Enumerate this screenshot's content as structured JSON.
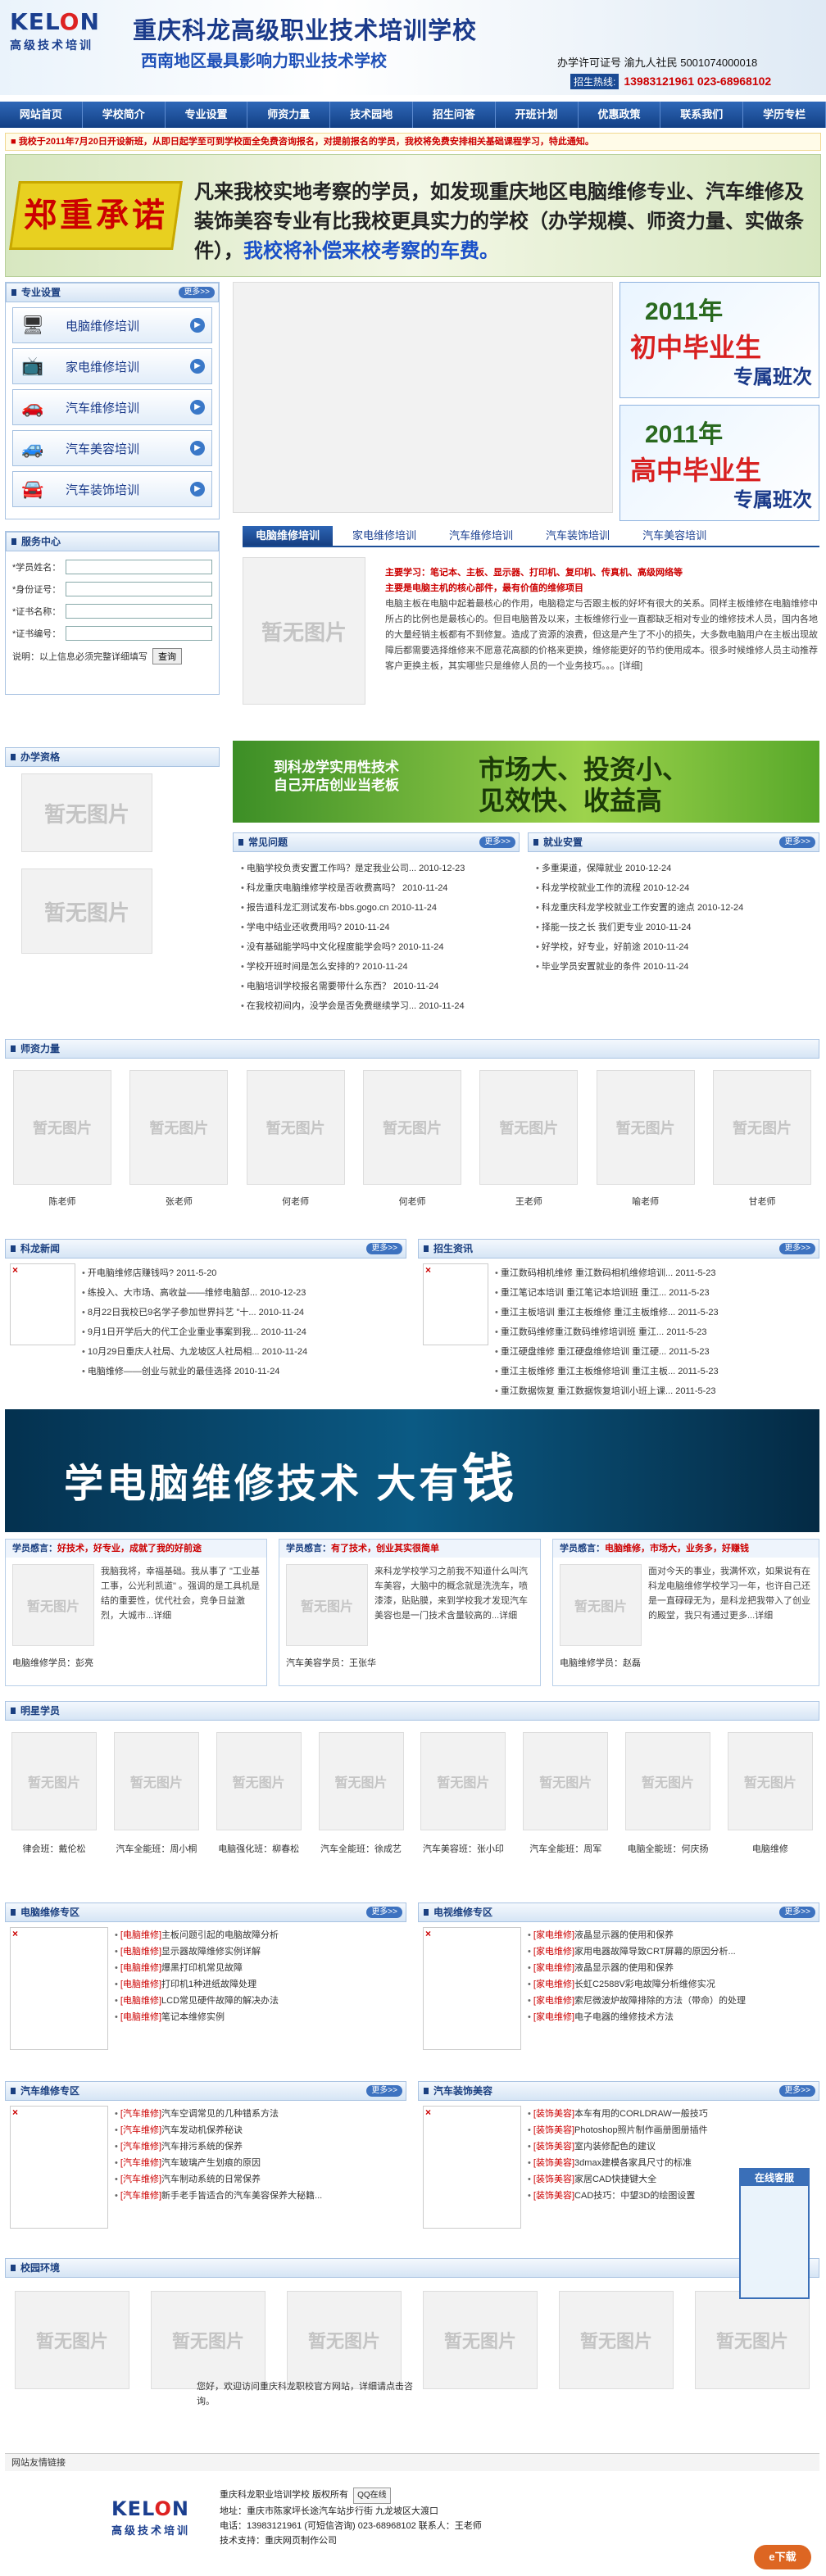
{
  "header": {
    "logo_mark_a": "KEL",
    "logo_mark_b": "O",
    "logo_mark_c": "N",
    "logo_sub": "高级技术培训",
    "title": "重庆科龙高级职业技术培训学校",
    "subtitle": "西南地区最具影响力职业技术学校",
    "license": "办学许可证号 渝九人社民 5001074000018",
    "phone_tag": "招生热线:",
    "phone": "13983121961  023-68968102"
  },
  "nav": [
    "网站首页",
    "学校简介",
    "专业设置",
    "师资力量",
    "技术园地",
    "招生问答",
    "开班计划",
    "优惠政策",
    "联系我们",
    "学历专栏"
  ],
  "notice": "■ 我校于2011年7月20日开设新班，从即日起学至可到学校面全免费咨询报名，对提前报名的学员，我校将免费安排相关基础课程学习，特此通知。",
  "promise": {
    "stamp": "郑重承诺",
    "text": "凡来我校实地考察的学员，如发现重庆地区电脑维修专业、汽车维修及装饰美容专业有比我校更具实力的学校（办学规模、师资力量、实做条件），",
    "highlight": "我校将补偿来校考察的车费。"
  },
  "major": {
    "title": "专业设置",
    "more": "更多>>",
    "items": [
      {
        "label": "电脑维修培训",
        "icon": "🖥"
      },
      {
        "label": "家电维修培训",
        "icon": "📺"
      },
      {
        "label": "汽车维修培训",
        "icon": "🚗"
      },
      {
        "label": "汽车美容培训",
        "icon": "🚙"
      },
      {
        "label": "汽车装饰培训",
        "icon": "🚘"
      }
    ]
  },
  "service": {
    "title": "服务中心",
    "fields": [
      "*学员姓名：",
      "*身份证号：",
      "*证书名称：",
      "*证书编号："
    ],
    "note": "说明：以上信息必须完整详细填写",
    "button": "查询"
  },
  "promos": [
    {
      "year": "2011年",
      "main": "初中毕业生",
      "tag": "专属班次"
    },
    {
      "year": "2011年",
      "main": "高中毕业生",
      "tag": "专属班次"
    }
  ],
  "placeholder": "暂无图片",
  "tabs": [
    "电脑维修培训",
    "家电维修培训",
    "汽车维修培训",
    "汽车装饰培训",
    "汽车美容培训"
  ],
  "tab_content": {
    "line1": "主要学习：笔记本、主板、显示器、打印机、复印机、传真机、高级网络等",
    "line2": "主要是电脑主机的核心部件，最有价值的维修项目",
    "body": "电脑主板在电脑中起着最核心的作用，电脑稳定与否跟主板的好坏有很大的关系。同样主板维修在电脑维修中所占的比例也是最核心的。但目电脑普及以来，主板维修行业一直都缺乏相对专业的维修技术人员，国内各地的大量经销主板都有不到修复。造成了资源的浪费，但这是产生了不小的损失，大多数电脑用户在主板出现故障后都需要选择维修来不愿意花高额的价格来更换，维修能更好的节约使用成本。很多时候维修人员主动推荐客户更换主板，其实哪些只是维修人员的一个业务技巧。。。[详细]"
  },
  "school": {
    "title": "办学资格"
  },
  "mid_banner": {
    "small": "到科龙学实用性技术\n自己开店创业当老板",
    "big": "市场大、投资小、\n见效快、收益高"
  },
  "faq": {
    "title": "常见问题",
    "more": "更多>>",
    "items": [
      "电脑学校负责安置工作吗？是定我业公司...  2010-12-23",
      "科龙重庆电脑维修学校是否收费高吗？  2010-11-24",
      "报告道科龙汇测试发布-bbs.gogo.cn 2010-11-24",
      "学电中结业还收费用吗?  2010-11-24",
      "没有基础能学吗中文化程度能学会吗?  2010-11-24",
      "学校开班时间是怎么安排的?  2010-11-24",
      "电脑培训学校报名需要带什么东西？  2010-11-24",
      "在我校初间内，没学会是否免费继续学习...  2010-11-24"
    ]
  },
  "job": {
    "title": "就业安置",
    "more": "更多>>",
    "items": [
      "多重渠道，保障就业  2010-12-24",
      "科龙学校就业工作的流程  2010-12-24",
      "科龙重庆科龙学校就业工作安置的途点  2010-12-24",
      "择能一技之长 我们更专业  2010-11-24",
      "好学校，好专业，好前途  2010-11-24",
      "毕业学员安置就业的条件  2010-11-24"
    ]
  },
  "teachers": {
    "title": "师资力量",
    "names": [
      "陈老师",
      "张老师",
      "何老师",
      "何老师",
      "王老师",
      "喻老师",
      "甘老师"
    ]
  },
  "news": {
    "title": "科龙新闻",
    "more": "更多>>",
    "items": [
      "开电脑维修店赚钱吗?  2011-5-20",
      "练投入、大市场、高收益——维修电脑部...  2010-12-23",
      "8月22日我校已9名学子参加世界抖艺 \"十...  2010-11-24",
      "9月1日开学后大的代工企业重业事案到我...  2010-11-24",
      "10月29日重庆人社局、九龙坡区人社局相...  2010-11-24",
      "电脑维修——创业与就业的最佳选择  2010-11-24"
    ]
  },
  "recruit": {
    "title": "招生资讯",
    "more": "更多>>",
    "items": [
      "重江数码相机维修 重江数码相机维修培训...  2011-5-23",
      "重江笔记本培训 重江笔记本培训班 重江...  2011-5-23",
      "重江主板培训 重江主板维修 重江主板维修...  2011-5-23",
      "重江数码维修重江数码维修培训班 重江...  2011-5-23",
      "重江硬盘维修 重江硬盘维修培训 重江硬...  2011-5-23",
      "重江主板维修 重江主板维修培训 重江主板...  2011-5-23",
      "重江数据恢复 重江数据恢复培训小班上课...  2011-5-23"
    ]
  },
  "tech_banner": {
    "text": "学电脑维修技术  大有",
    "big": "钱"
  },
  "testimonials": [
    {
      "head": "学员感言：",
      "hot": "好技术，好专业，成就了我的好前途",
      "text": "我脑我将，幸福基础。我从事了 \"工业基工事，公光利凯道\" 。强调的是工具机是结的重要性，优代社会，竞争日益激烈，大城市...详细",
      "foot": "电脑维修学员：彭亮"
    },
    {
      "head": "学员感言：",
      "hot": "有了技术，创业其实很简单",
      "text": "来科龙学校学习之前我不知道什么叫汽车美容，大脑中的概念就是洗洗车，喷漆漆，贴贴膜，来到学校我才发现汽车美容也是一门技术含量较高的...详细",
      "foot": "汽车美容学员：王张华"
    },
    {
      "head": "学员感言：",
      "hot": "电脑维修，市场大，业务多，好赚钱",
      "text": "面对今天的事业，我满怀欢，如果说有在科龙电脑维修学校学习一年，也许自己还是一直碌碌无为，是科龙把我带入了创业的殿堂，我只有通过更多...详细",
      "foot": "电脑维修学员：赵磊"
    }
  ],
  "stars": {
    "title": "明星学员",
    "names": [
      "律会班：戴伦松",
      "汽车全能班：周小桐",
      "电脑强化班：柳春松",
      "汽车全能班：徐成艺",
      "汽车美容班：张小印",
      "汽车全能班：周军",
      "电脑全能班：何庆扬",
      "电脑维修"
    ]
  },
  "zones": [
    {
      "title": "电脑维修专区",
      "tag": "[电脑维修]",
      "more": "更多>>",
      "items": [
        "主板问题引起的电脑故障分析",
        "显示器故障维修实例详解",
        "爆黑打印机常见故障",
        "打印机1种进纸故障处理",
        "LCD常见硬件故障的解决办法",
        "笔记本维修实例"
      ]
    },
    {
      "title": "电视维修专区",
      "tag": "[家电维修]",
      "more": "更多>>",
      "items": [
        "液晶显示器的使用和保养",
        "家用电器故障导致CRT屏幕的原因分析...",
        "液晶显示器的使用和保养",
        "长虹C2588V彩电故障分析维修实况",
        "索尼微波炉故障排除的方法（带命）的处理",
        "电子电器的维修技术方法"
      ]
    },
    {
      "title": "汽车维修专区",
      "tag": "[汽车维修]",
      "more": "更多>>",
      "items": [
        "汽车空调常见的几种错系方法",
        "汽车发动机保养秘诀",
        "汽车排污系统的保养",
        "汽车玻璃产生划痕的原因",
        "汽车制动系统的日常保养",
        "新手老手皆适合的汽车美容保养大秘籍..."
      ]
    },
    {
      "title": "汽车装饰美容",
      "tag": "[装饰美容]",
      "more": "更多>>",
      "items": [
        "本车有用的CORLDRAW一般技巧",
        "Photoshop照片制作画册图册插件",
        "室内装修配色的建议",
        "3dmax建模各家具尺寸的标准",
        "家居CAD快捷键大全",
        "CAD技巧：中望3D的绘图设置"
      ]
    }
  ],
  "campus": {
    "title": "校园环境",
    "text": "您好，欢迎访问重庆科龙职校官方网站，详细请点击咨询。"
  },
  "online": {
    "title": "在线客服"
  },
  "friend": "网站友情链接",
  "footer": {
    "line1": "重庆科龙职业培训学校 版权所有",
    "qq": "QQ在线",
    "line2": "地址：重庆市陈家坪长途汽车站步行街 九龙坡区大渡口",
    "line3": "电话：13983121961 (可短信咨询)  023-68968102  联系人：王老师",
    "line4": "技术支持：重庆网页制作公司",
    "badge": "e下载"
  }
}
